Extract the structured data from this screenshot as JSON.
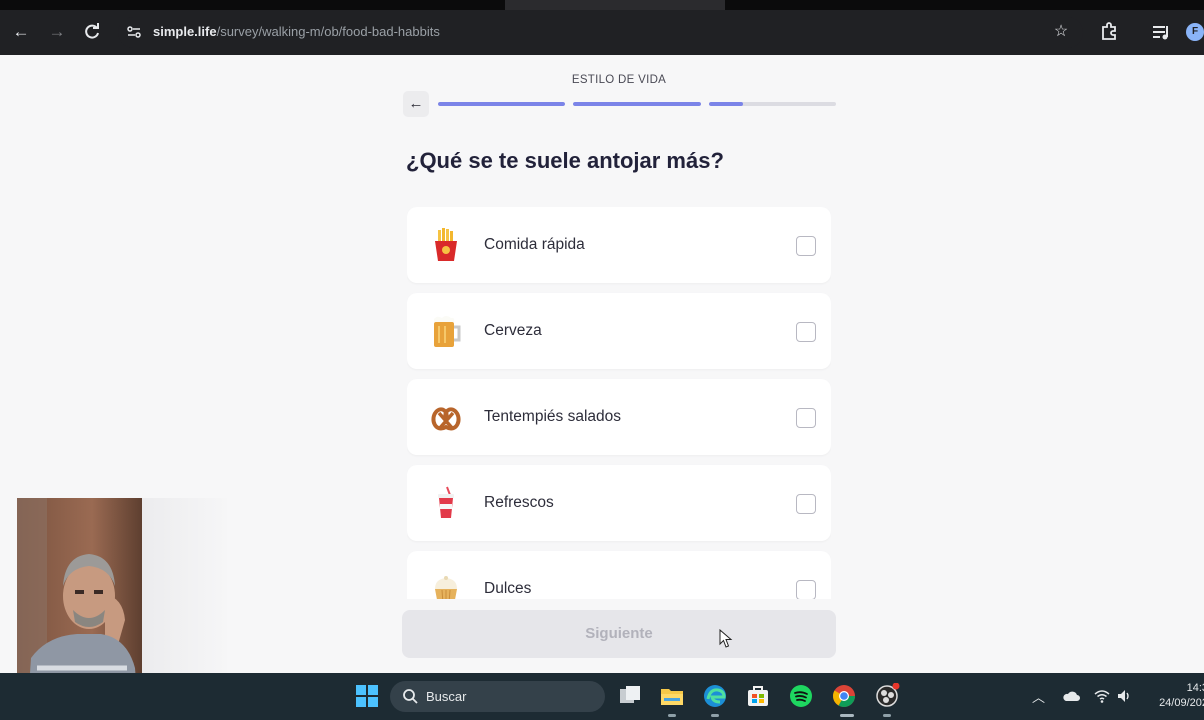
{
  "browser": {
    "url_host": "simple.life",
    "url_path": "/survey/walking-m/ob/food-bad-habbits",
    "profile_initial": "F"
  },
  "survey": {
    "step_label": "ESTILO DE VIDA",
    "progress": [
      1.0,
      1.0,
      0.27
    ],
    "question": "¿Qué se te suele antojar más?",
    "options": [
      {
        "label": "Comida rápida",
        "icon": "fries-icon",
        "checked": false
      },
      {
        "label": "Cerveza",
        "icon": "beer-mug-icon",
        "checked": false
      },
      {
        "label": "Tentempiés salados",
        "icon": "pretzel-icon",
        "checked": false
      },
      {
        "label": "Refrescos",
        "icon": "soft-drink-cup-icon",
        "checked": false
      },
      {
        "label": "Dulces",
        "icon": "cupcake-icon",
        "checked": false
      }
    ],
    "next_button": "Siguiente",
    "accent": "#7b84e8"
  },
  "taskbar": {
    "search_label": "Buscar",
    "time": "14:3",
    "date": "24/09/202"
  }
}
